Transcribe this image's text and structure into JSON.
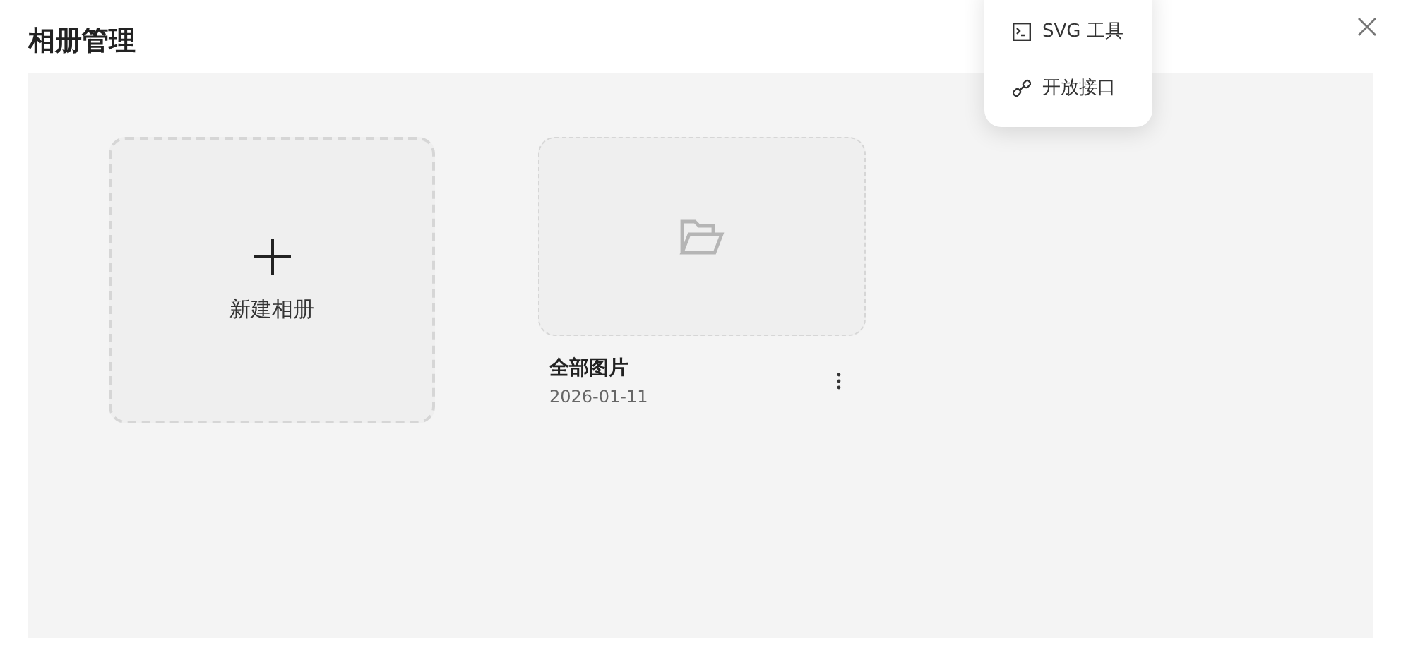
{
  "dialog": {
    "title": "相册管理"
  },
  "menu": [
    {
      "kind": "terminal",
      "label": "SVG 工具"
    },
    {
      "kind": "link",
      "label": "开放接口"
    }
  ],
  "new_album": {
    "label": "新建相册"
  },
  "albums": [
    {
      "title": "全部图片",
      "date": "2026-01-11"
    }
  ]
}
